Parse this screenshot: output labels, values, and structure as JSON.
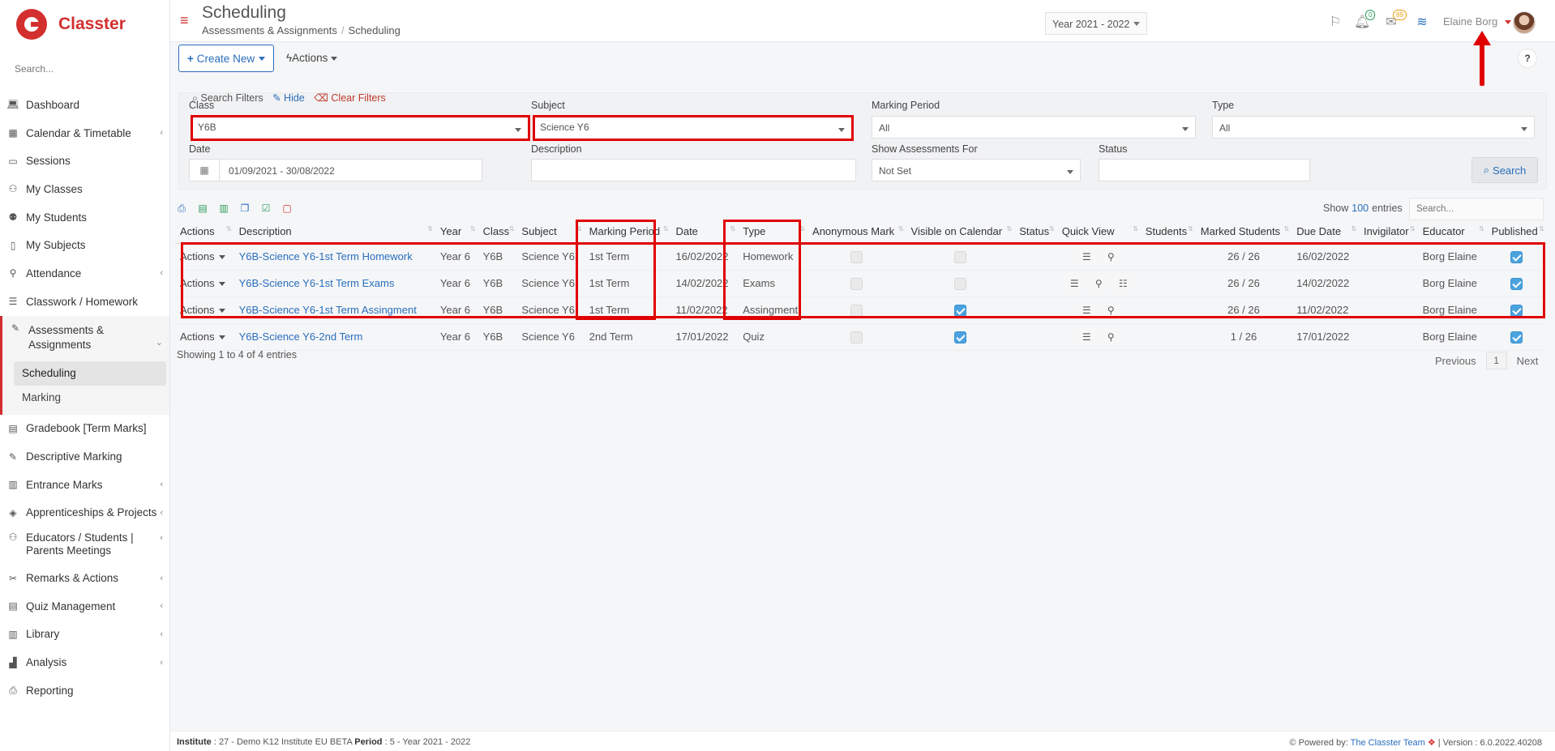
{
  "app": {
    "name": "Classter"
  },
  "sidebar": {
    "search_placeholder": "Search...",
    "items": [
      {
        "label": "Dashboard",
        "icon": "laptop-icon",
        "chevron": false
      },
      {
        "label": "Calendar & Timetable",
        "icon": "calendar-icon",
        "chevron": true
      },
      {
        "label": "Sessions",
        "icon": "presentation-icon",
        "chevron": false
      },
      {
        "label": "My Classes",
        "icon": "users-icon",
        "chevron": false
      },
      {
        "label": "My Students",
        "icon": "students-icon",
        "chevron": false
      },
      {
        "label": "My Subjects",
        "icon": "book-icon",
        "chevron": false
      },
      {
        "label": "Attendance",
        "icon": "user-check-icon",
        "chevron": true
      },
      {
        "label": "Classwork / Homework",
        "icon": "list-icon",
        "chevron": false
      }
    ],
    "active": {
      "label": "Assessments & Assignments",
      "sub": [
        "Scheduling",
        "Marking"
      ]
    },
    "items_after": [
      {
        "label": "Gradebook [Term Marks]",
        "icon": "gradebook-icon",
        "chevron": false
      },
      {
        "label": "Descriptive Marking",
        "icon": "edit-icon",
        "chevron": false
      },
      {
        "label": "Entrance Marks",
        "icon": "clipboard-icon",
        "chevron": true
      },
      {
        "label": "Apprenticeships & Projects",
        "icon": "cube-icon",
        "chevron": true
      },
      {
        "label": "Educators / Students | Parents Meetings",
        "icon": "meeting-icon",
        "chevron": true
      },
      {
        "label": "Remarks & Actions",
        "icon": "remarks-icon",
        "chevron": true
      },
      {
        "label": "Quiz Management",
        "icon": "quiz-icon",
        "chevron": true
      },
      {
        "label": "Library",
        "icon": "library-icon",
        "chevron": true
      },
      {
        "label": "Analysis",
        "icon": "chart-icon",
        "chevron": true
      },
      {
        "label": "Reporting",
        "icon": "printer-icon",
        "chevron": false
      }
    ]
  },
  "header": {
    "title": "Scheduling",
    "breadcrumb": [
      "Assessments & Assignments",
      "Scheduling"
    ],
    "year": "Year 2021 - 2022",
    "notifications_count": "0",
    "messages_count": "89",
    "user_name": "Elaine Borg"
  },
  "toolbar": {
    "create_label": "Create New",
    "actions_label": "Actions",
    "help_label": "?"
  },
  "filters": {
    "heading": "Search Filters",
    "hide_label": "Hide",
    "clear_label": "Clear Filters",
    "class_label": "Class",
    "class_value": "Y6B",
    "subject_label": "Subject",
    "subject_value": "Science Y6",
    "marking_period_label": "Marking Period",
    "marking_period_value": "All",
    "type_label": "Type",
    "type_value": "All",
    "date_label": "Date",
    "date_value": "01/09/2021 - 30/08/2022",
    "description_label": "Description",
    "description_value": "",
    "show_for_label": "Show Assessments For",
    "show_for_value": "Not Set",
    "status_label": "Status",
    "status_value": "",
    "search_label": "Search"
  },
  "table": {
    "show_label": "Show",
    "entries_count": "100",
    "entries_label": "entries",
    "search_placeholder": "Search...",
    "columns": [
      "Actions",
      "Description",
      "Year",
      "Class",
      "Subject",
      "Marking Period",
      "Date",
      "Type",
      "Anonymous Mark",
      "Visible on Calendar",
      "Status",
      "Quick View",
      "Students",
      "Marked Students",
      "Due Date",
      "Invigilator",
      "Educator",
      "Published"
    ],
    "rows": [
      {
        "actions": "Actions",
        "description": "Y6B-Science Y6-1st Term Homework",
        "year": "Year 6",
        "class": "Y6B",
        "subject": "Science Y6",
        "period": "1st Term",
        "date": "16/02/2022",
        "type": "Homework",
        "anonymous": false,
        "visible": false,
        "status": "",
        "quick_view": [
          "list-icon",
          "user-check-icon"
        ],
        "students": "",
        "marked": "26 / 26",
        "due": "16/02/2022",
        "invigilator": "",
        "educator": "Borg Elaine",
        "published": true
      },
      {
        "actions": "Actions",
        "description": "Y6B-Science Y6-1st Term Exams",
        "year": "Year 6",
        "class": "Y6B",
        "subject": "Science Y6",
        "period": "1st Term",
        "date": "14/02/2022",
        "type": "Exams",
        "anonymous": false,
        "visible": false,
        "status": "",
        "quick_view": [
          "list-icon",
          "user-check-icon",
          "list-ul-icon"
        ],
        "students": "",
        "marked": "26 / 26",
        "due": "14/02/2022",
        "invigilator": "",
        "educator": "Borg Elaine",
        "published": true
      },
      {
        "actions": "Actions",
        "description": "Y6B-Science Y6-1st Term Assingment",
        "year": "Year 6",
        "class": "Y6B",
        "subject": "Science Y6",
        "period": "1st Term",
        "date": "11/02/2022",
        "type": "Assingment",
        "anonymous": false,
        "visible": true,
        "status": "",
        "quick_view": [
          "list-icon",
          "user-check-icon"
        ],
        "students": "",
        "marked": "26 / 26",
        "due": "11/02/2022",
        "invigilator": "",
        "educator": "Borg Elaine",
        "published": true
      },
      {
        "actions": "Actions",
        "description": "Y6B-Science Y6-2nd Term",
        "year": "Year 6",
        "class": "Y6B",
        "subject": "Science Y6",
        "period": "2nd Term",
        "date": "17/01/2022",
        "type": "Quiz",
        "anonymous": false,
        "visible": true,
        "status": "",
        "quick_view": [
          "list-icon",
          "user-check-icon"
        ],
        "students": "",
        "marked": "1 / 26",
        "due": "17/01/2022",
        "invigilator": "",
        "educator": "Borg Elaine",
        "published": true
      }
    ],
    "showing_text": "Showing 1 to 4 of 4 entries",
    "prev_label": "Previous",
    "page": "1",
    "next_label": "Next"
  },
  "footer": {
    "institute_label": "Institute",
    "institute_value": ": 27 - Demo K12 Institute EU BETA",
    "period_label": "Period",
    "period_value": ": 5 - Year 2021 - 2022",
    "powered_label": "Powered by:",
    "powered_team": "The Classter Team",
    "version": "| Version : 6.0.2022.40208"
  },
  "colors": {
    "brand": "#d32f2f",
    "link": "#2a6ebb",
    "highlight": "#e00000",
    "checkbox_on": "#4aa3df"
  }
}
